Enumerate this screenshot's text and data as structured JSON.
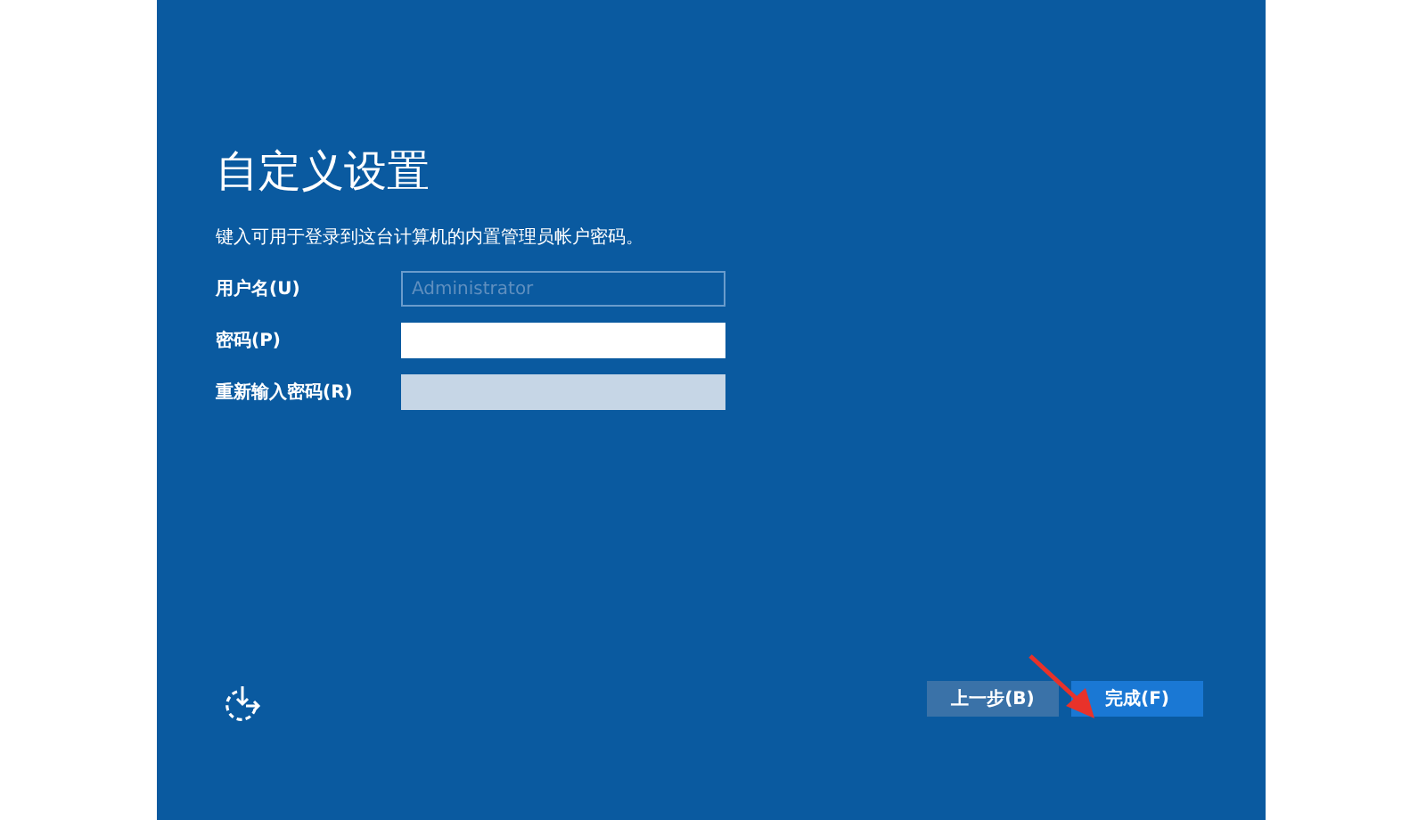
{
  "title": "自定义设置",
  "description": "键入可用于登录到这台计算机的内置管理员帐户密码。",
  "fields": [
    {
      "label": "用户名(U)",
      "value": "Administrator",
      "disabled": true
    },
    {
      "label": "密码(P)",
      "disabled": false
    },
    {
      "label": "重新输入密码(R)",
      "disabled": true
    }
  ],
  "buttons": [
    {
      "label": "上一步(B)",
      "primary": false
    },
    {
      "label": "完成(F)",
      "primary": true
    }
  ],
  "annotation_arrow": true
}
